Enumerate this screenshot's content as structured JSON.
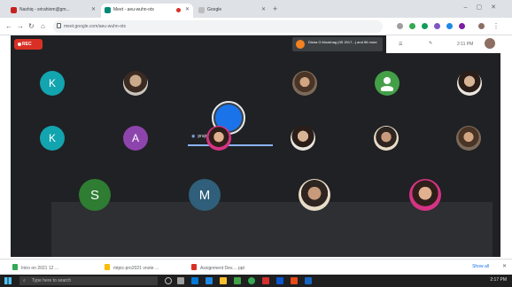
{
  "browser": {
    "tabs": [
      {
        "label": "Nashiq - srirahiom@gm..."
      },
      {
        "label": "Meet - aeu-wuhn-ots"
      },
      {
        "label": "Google"
      }
    ],
    "url": "meet.google.com/aeu-wuhn-ots"
  },
  "meet": {
    "recording_label": "REC",
    "notice_text": "Disha G Mookhag (IIS 2017...) and 56 more",
    "presenter_name": "prajna spandi",
    "participants_row1": [
      {
        "letter": "K",
        "color": "#12a4af",
        "kind": "letter"
      },
      {
        "letter": "",
        "color": "#5b6770",
        "kind": "photo"
      },
      {
        "letter": "",
        "color": "#1a73e8",
        "kind": "presenter"
      },
      {
        "letter": "",
        "color": "#7b6a5a",
        "kind": "photo"
      },
      {
        "letter": "",
        "color": "#43a047",
        "kind": "silhouette"
      },
      {
        "letter": "",
        "color": "#c9c4bd",
        "kind": "photo"
      }
    ],
    "participants_row2": [
      {
        "letter": "K",
        "color": "#12a4af",
        "kind": "letter"
      },
      {
        "letter": "A",
        "color": "#8e44ad",
        "kind": "letter"
      },
      {
        "letter": "",
        "color": "#d63384",
        "kind": "photo"
      },
      {
        "letter": "",
        "color": "#c9c4bd",
        "kind": "photo"
      },
      {
        "letter": "",
        "color": "#e9e5df",
        "kind": "photo"
      },
      {
        "letter": "",
        "color": "#c9c4bd",
        "kind": "photo"
      }
    ],
    "participants_row3": [
      {
        "letter": "S",
        "color": "#2e7d32",
        "kind": "letter"
      },
      {
        "letter": "M",
        "color": "#2f5f7a",
        "kind": "letter"
      },
      {
        "letter": "",
        "color": "#e8dcc8",
        "kind": "photo"
      },
      {
        "letter": "",
        "color": "#d63384",
        "kind": "photo"
      }
    ],
    "top_panel": {
      "time": "2:11 PM"
    }
  },
  "downloads": {
    "items": [
      {
        "label": "Intro on 2021 12 ..."
      },
      {
        "label": "mtpic-pro2021 vnote ..."
      },
      {
        "label": "Assignment Dev.... ppt"
      }
    ],
    "show_all": "Show all"
  },
  "taskbar": {
    "search_placeholder": "Type here to search",
    "time": "2:17 PM"
  }
}
